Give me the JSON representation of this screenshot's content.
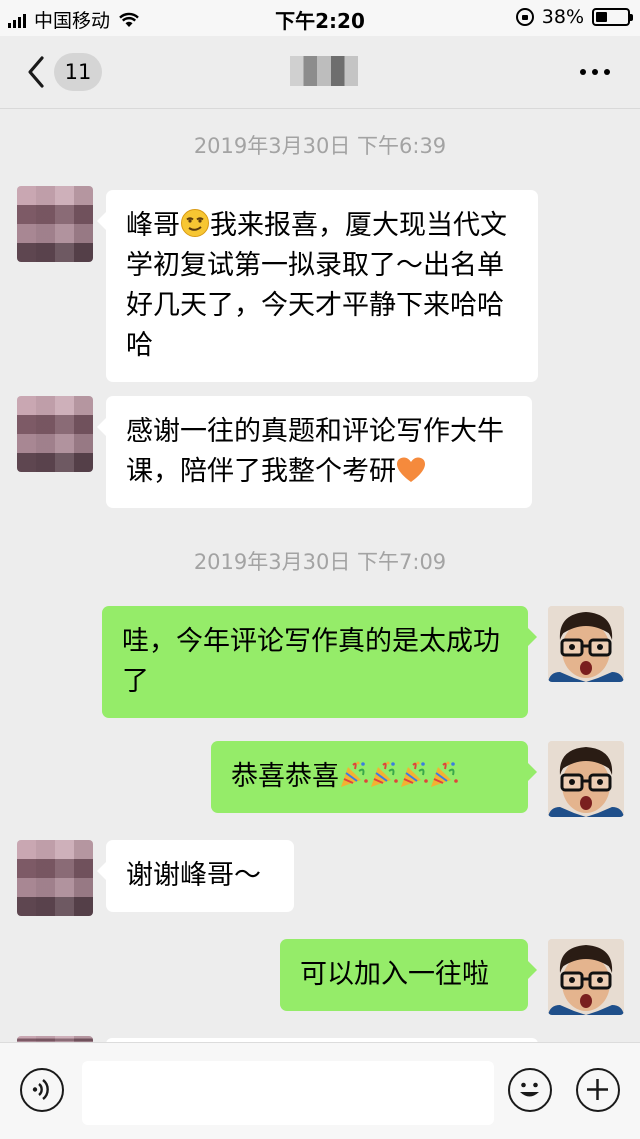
{
  "status_bar": {
    "carrier": "中国移动",
    "time": "下午2:20",
    "battery": "38%",
    "battery_level": 0.38
  },
  "nav": {
    "unread_count": "11"
  },
  "timestamps": [
    "2019年3月30日 下午6:39",
    "2019年3月30日 下午7:09"
  ],
  "messages": [
    {
      "side": "in",
      "text_a": "峰哥",
      "emoji_a": "smirk-face-emoji",
      "text_b": "我来报喜，厦大现当代文学初复试第一拟录取了～出名单好几天了，今天才平静下来哈哈哈"
    },
    {
      "side": "in",
      "text_a": "感谢一往的真题和评论写作大牛课，陪伴了我整个考研",
      "emoji_a": "orange-heart-emoji"
    },
    {
      "side": "out",
      "text_a": "哇，今年评论写作真的是太成功了"
    },
    {
      "side": "out",
      "text_a": "恭喜恭喜",
      "emoji_a": "party-popper-emoji"
    },
    {
      "side": "in",
      "text_a": "谢谢峰哥～"
    },
    {
      "side": "out",
      "text_a": "可以加入一往啦"
    }
  ],
  "input": {
    "placeholder": ""
  },
  "colors": {
    "incoming_bubble": "#ffffff",
    "outgoing_bubble": "#95ec69",
    "background": "#ededed",
    "timestamp": "#a3a3a3"
  },
  "icons": [
    "back-chevron-icon",
    "more-icon",
    "voice-icon",
    "emoji-icon",
    "plus-icon",
    "signal-icon",
    "wifi-icon",
    "rotation-lock-icon",
    "battery-icon"
  ]
}
